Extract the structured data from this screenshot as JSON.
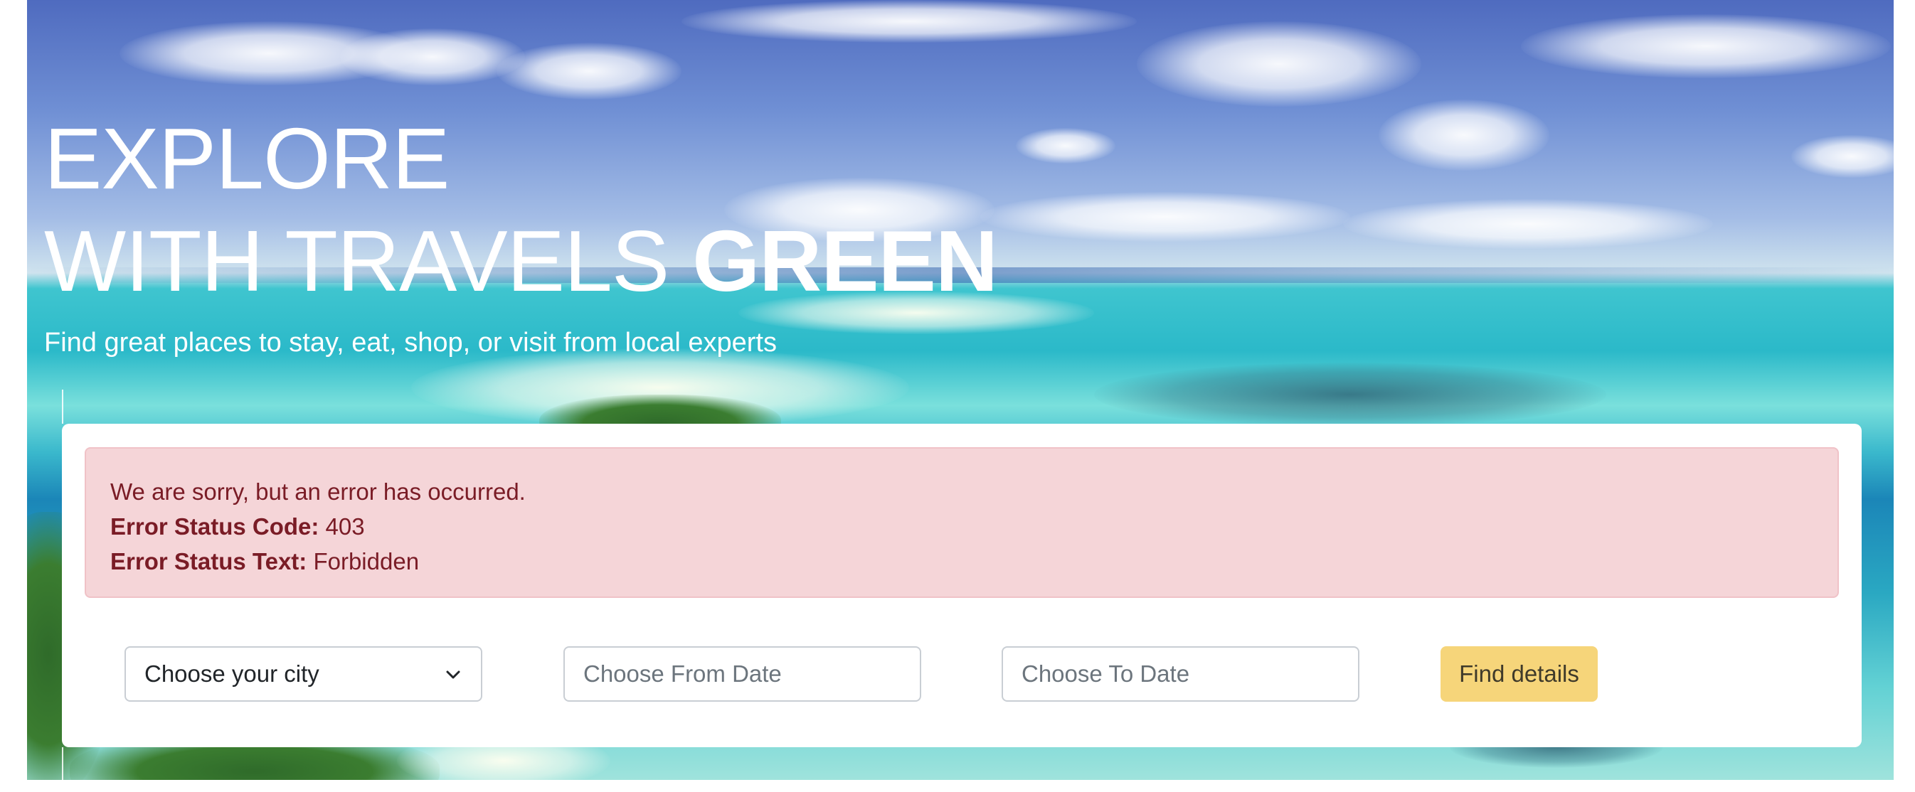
{
  "hero": {
    "title_line1": "EXPLORE",
    "title_line2_light": "WITH TRAVELS ",
    "title_line2_bold": "GREEN",
    "subtitle": "Find great places to stay, eat, shop, or visit from local experts"
  },
  "alert": {
    "message": "We are sorry, but an error has occurred.",
    "status_code_label": "Error Status Code:",
    "status_code_value": " 403",
    "status_text_label": "Error Status Text:",
    "status_text_value": " Forbidden",
    "colors": {
      "background": "#f5d5d8",
      "text": "#7a1c26"
    }
  },
  "search": {
    "city_select": {
      "selected": "Choose your city",
      "icon": "chevron-down-icon"
    },
    "from_date_placeholder": "Choose From Date",
    "to_date_placeholder": "Choose To Date",
    "find_button_label": "Find details",
    "colors": {
      "button": "#f6d57a"
    }
  }
}
